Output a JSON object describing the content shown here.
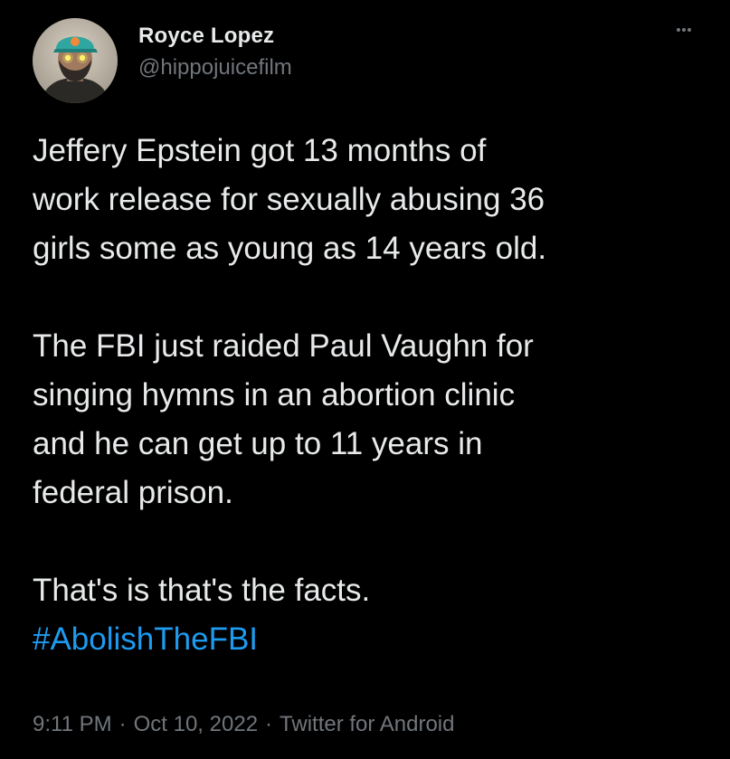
{
  "tweet": {
    "author": {
      "display_name": "Royce Lopez",
      "handle": "@hippojuicefilm",
      "avatar_icon": "avatar-photo"
    },
    "more_icon": "more-dots-icon",
    "text": {
      "lines_para1": [
        "Jeffery Epstein got 13 months of",
        "work release for sexually abusing 36",
        "girls some as young as 14 years old."
      ],
      "lines_para2": [
        "The FBI just raided Paul Vaughn for",
        "singing hymns in an abortion clinic",
        "and he can get up to 11 years in",
        "federal prison."
      ],
      "line_para3": "That's is that's the facts.",
      "hashtag": "#AbolishTheFBI"
    },
    "meta": {
      "time": "9:11 PM",
      "separator": "·",
      "date": "Oct 10, 2022",
      "source": "Twitter for Android"
    },
    "colors": {
      "background": "#000000",
      "text": "#e7e9ea",
      "secondary": "#71767b",
      "link": "#1d9bf0"
    }
  }
}
